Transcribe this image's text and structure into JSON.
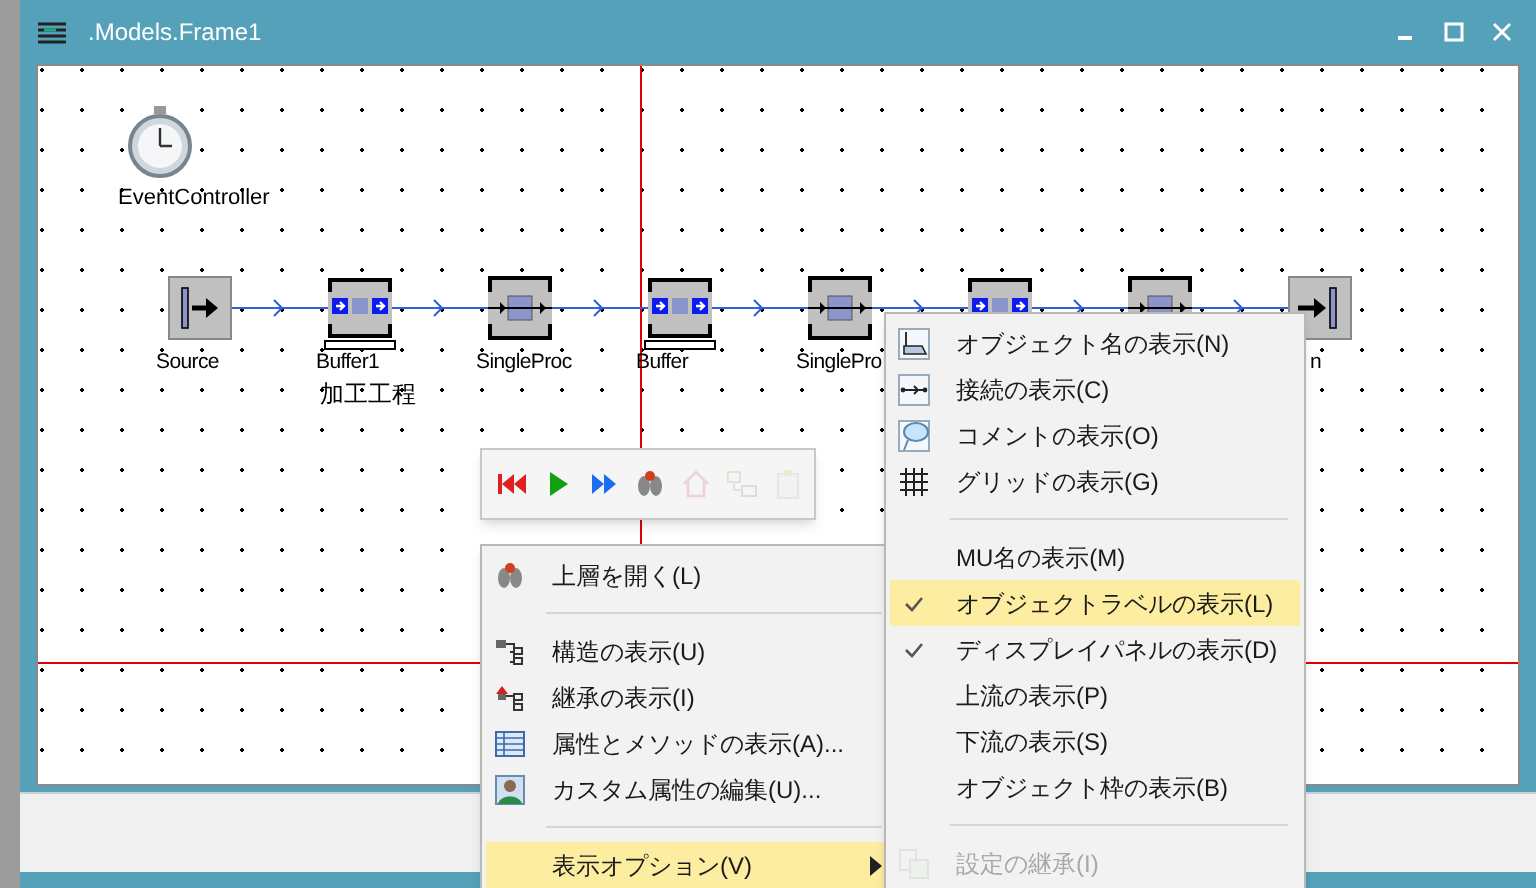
{
  "window": {
    "title": ".Models.Frame1"
  },
  "canvas": {
    "event_controller": {
      "label": "EventController"
    },
    "nodes": [
      {
        "kind": "source",
        "label": "Source"
      },
      {
        "kind": "buffer",
        "label": "Buffer1",
        "sublabel": "加工工程"
      },
      {
        "kind": "single_proc",
        "label": "SingleProc"
      },
      {
        "kind": "buffer",
        "label": "Buffer"
      },
      {
        "kind": "single_proc",
        "label": "SinglePro"
      },
      {
        "kind": "buffer"
      },
      {
        "kind": "single_proc"
      },
      {
        "kind": "drain",
        "label": "n"
      }
    ]
  },
  "toolbar": {
    "buttons": [
      {
        "disabled": false
      },
      {
        "disabled": false
      },
      {
        "disabled": false
      },
      {
        "disabled": false
      },
      {
        "disabled": true
      },
      {
        "disabled": true
      },
      {
        "disabled": true
      }
    ]
  },
  "context_menu": {
    "items": [
      {
        "kind": "item",
        "label": "上層を開く(L)",
        "highlighted": false,
        "submenu": false
      },
      {
        "kind": "separator"
      },
      {
        "kind": "item",
        "label": "構造の表示(U)",
        "highlighted": false,
        "submenu": false
      },
      {
        "kind": "item",
        "label": "継承の表示(I)",
        "highlighted": false,
        "submenu": false
      },
      {
        "kind": "item",
        "label": "属性とメソッドの表示(A)...",
        "highlighted": false,
        "submenu": false
      },
      {
        "kind": "item",
        "label": "カスタム属性の編集(U)...",
        "highlighted": false,
        "submenu": false
      },
      {
        "kind": "separator"
      },
      {
        "kind": "item",
        "label": "表示オプション(V)",
        "highlighted": true,
        "submenu": true
      }
    ]
  },
  "submenu": {
    "items": [
      {
        "kind": "item",
        "label": "オブジェクト名の表示(N)",
        "checked": false,
        "highlighted": false,
        "disabled": false
      },
      {
        "kind": "item",
        "label": "接続の表示(C)",
        "checked": false,
        "highlighted": false,
        "disabled": false
      },
      {
        "kind": "item",
        "label": "コメントの表示(O)",
        "checked": false,
        "highlighted": false,
        "disabled": false
      },
      {
        "kind": "item",
        "label": "グリッドの表示(G)",
        "checked": false,
        "highlighted": false,
        "disabled": false
      },
      {
        "kind": "separator"
      },
      {
        "kind": "item",
        "label": "MU名の表示(M)",
        "checked": false,
        "highlighted": false,
        "disabled": false
      },
      {
        "kind": "item",
        "label": "オブジェクトラベルの表示(L)",
        "checked": true,
        "highlighted": true,
        "disabled": false
      },
      {
        "kind": "item",
        "label": "ディスプレイパネルの表示(D)",
        "checked": true,
        "highlighted": false,
        "disabled": false
      },
      {
        "kind": "item",
        "label": "上流の表示(P)",
        "checked": false,
        "highlighted": false,
        "disabled": false
      },
      {
        "kind": "item",
        "label": "下流の表示(S)",
        "checked": false,
        "highlighted": false,
        "disabled": false
      },
      {
        "kind": "item",
        "label": "オブジェクト枠の表示(B)",
        "checked": false,
        "highlighted": false,
        "disabled": false
      },
      {
        "kind": "separator"
      },
      {
        "kind": "item",
        "label": "設定の継承(I)",
        "checked": false,
        "highlighted": false,
        "disabled": true
      }
    ]
  }
}
